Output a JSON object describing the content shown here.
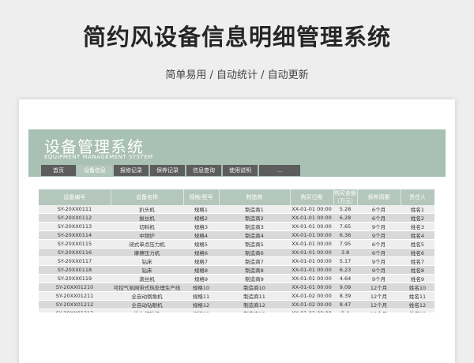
{
  "page": {
    "title": "简约风设备信息明细管理系统",
    "subtitle": "简单易用 / 自动统计 / 自动更新"
  },
  "banner": {
    "title": "设备管理系统",
    "subtitle": "EQUIPMENT MANAGEMENT SYSTEM"
  },
  "tabs": [
    {
      "label": "首页",
      "active": false
    },
    {
      "label": "设备信息",
      "active": true
    },
    {
      "label": "报修记录",
      "active": false
    },
    {
      "label": "保养记录",
      "active": false
    },
    {
      "label": "信息查询",
      "active": false
    },
    {
      "label": "使用说明",
      "active": false
    },
    {
      "label": "...",
      "active": false
    }
  ],
  "table": {
    "headers": [
      "设备编号",
      "设备名称",
      "规格/型号",
      "制造商",
      "购买日期",
      "购买金额（万元）",
      "保养周期",
      "责任人"
    ],
    "rows": [
      [
        "SY-20XX0111",
        "扒头机",
        "规格1",
        "制造商1",
        "XX-01-01 00:00",
        "5.28",
        "6个月",
        "姓名1"
      ],
      [
        "SY-20XX0112",
        "拔丝机",
        "规格2",
        "制造商2",
        "XX-01-01 00:00",
        "6.28",
        "6个月",
        "姓名2"
      ],
      [
        "SY-20XX0113",
        "切料机",
        "规格3",
        "制造商3",
        "XX-01-01 00:00",
        "7.65",
        "9个月",
        "姓名3"
      ],
      [
        "SY-20XX0114",
        "中频炉",
        "规格4",
        "制造商4",
        "XX-01-01 00:00",
        "6.36",
        "9个月",
        "姓名4"
      ],
      [
        "SY-20XX0115",
        "闭式单点压力机",
        "规格5",
        "制造商5",
        "XX-01-01 00:00",
        "7.95",
        "6个月",
        "姓名5"
      ],
      [
        "SY-20XX0116",
        "摩擦压力机",
        "规格6",
        "制造商6",
        "XX-01-01 00:00",
        "3.8",
        "6个月",
        "姓名6"
      ],
      [
        "SY-20XX0117",
        "钻床",
        "规格7",
        "制造商7",
        "XX-01-01 00:00",
        "5.17",
        "9个月",
        "姓名7"
      ],
      [
        "SY-20XX0118",
        "钻床",
        "规格8",
        "制造商8",
        "XX-01-01 00:00",
        "6.23",
        "9个月",
        "姓名8"
      ],
      [
        "SY-20XX0119",
        "滚丝机",
        "规格9",
        "制造商9",
        "XX-01-01 00:00",
        "4.64",
        "9个月",
        "姓名9"
      ],
      [
        "SY-20XX01210",
        "可控气氛网带式热处理生产线",
        "规格10",
        "制造商10",
        "XX-01-01 00:00",
        "9.09",
        "12个月",
        "姓名10"
      ],
      [
        "SY-20XX01211",
        "全自动倒角机",
        "规格11",
        "制造商11",
        "XX-01-02 00:00",
        "8.39",
        "12个月",
        "姓名11"
      ],
      [
        "SY-20XX01212",
        "全自动钻眼机",
        "规格12",
        "制造商12",
        "XX-01-02 00:00",
        "8.47",
        "12个月",
        "姓名12"
      ],
      [
        "SY-20XX01213",
        "抛丸打砂机",
        "规格13",
        "制造商13",
        "XX-01-02 00:00",
        "9.4",
        "12个月",
        "姓名13"
      ]
    ]
  }
}
